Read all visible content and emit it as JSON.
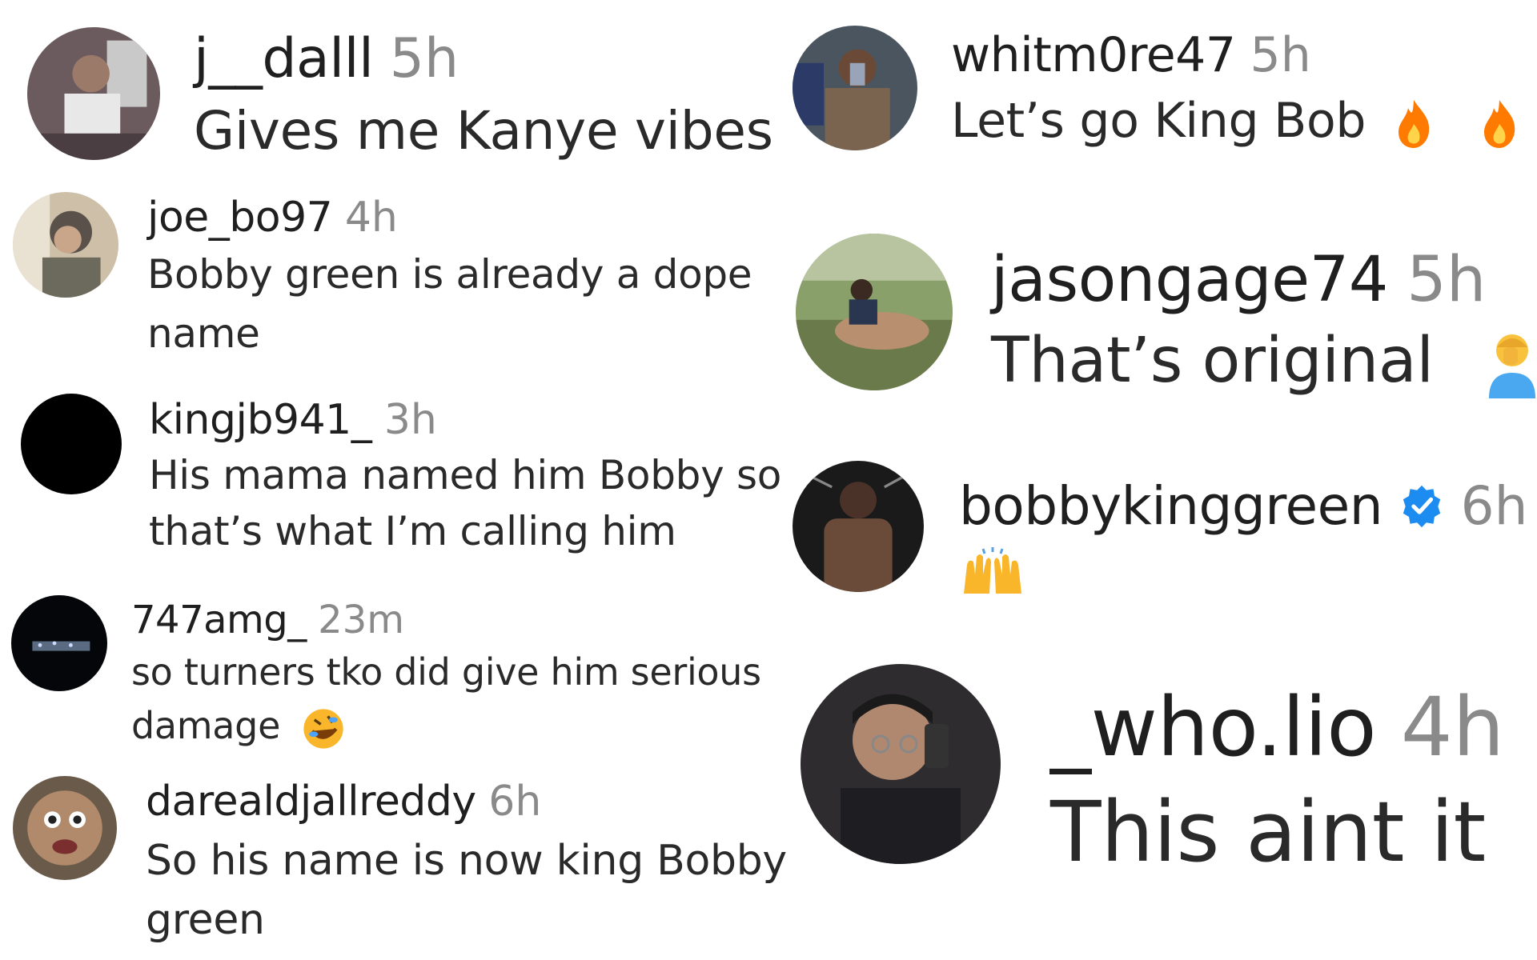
{
  "comments": [
    {
      "username": "j__dalll",
      "time": "5h",
      "text": "Gives me Kanye vibes"
    },
    {
      "username": "joe_bo97",
      "time": "4h",
      "text_line1": "Bobby green is already a dope",
      "text_line2": "name"
    },
    {
      "username": "kingjb941_",
      "time": "3h",
      "text_line1": "His mama named him Bobby so",
      "text_line2": "that’s what I’m calling him"
    },
    {
      "username": "747amg_",
      "time": "23m",
      "text_line1": "so turners tko did give him serious",
      "text_line2": "damage",
      "emoji": "rolling-on-floor-laughing-emoji"
    },
    {
      "username": "darealdjallreddy",
      "time": "6h",
      "text_line1": "So his name is now king Bobby",
      "text_line2": "green"
    },
    {
      "username": "whitm0re47",
      "time": "5h",
      "text": "Let’s go King Bob",
      "emoji": "fire-emoji"
    },
    {
      "username": "jasongage74",
      "time": "5h",
      "text": "That’s original",
      "emoji": "person-facepalming-emoji"
    },
    {
      "username": "bobbykinggreen",
      "time": "6h",
      "verified": true,
      "emoji": "raising-hands-emoji"
    },
    {
      "username": "_who.lio",
      "time": "4h",
      "text": "This aint it"
    }
  ],
  "colors": {
    "username": "#1f1f1f",
    "timestamp": "#8a8a8a",
    "verified": "#1d8cf0",
    "fire": "#ff7a00"
  }
}
